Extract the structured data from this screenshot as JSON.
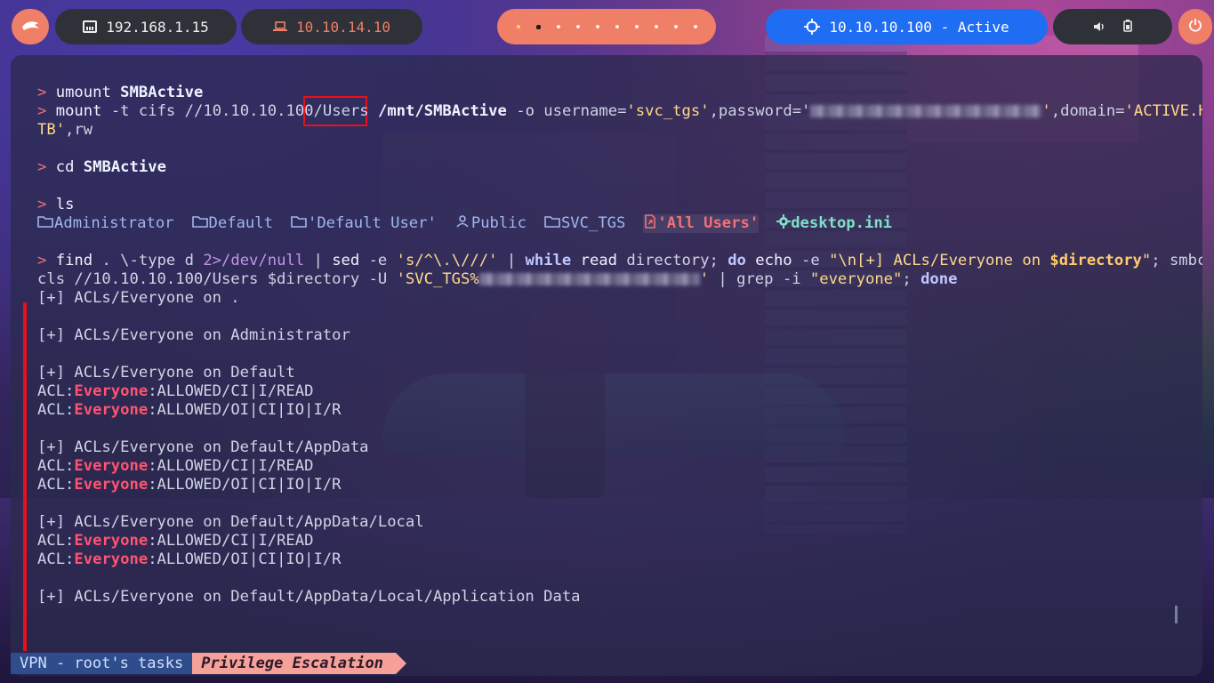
{
  "topbar": {
    "local_ip": "192.168.1.15",
    "vpn_ip": "10.10.14.10",
    "target": "10.10.10.100 - Active",
    "workspace_count": 10,
    "active_workspace_index": 1
  },
  "terminal": {
    "prompt_symbol": ">",
    "cmd1": {
      "c": "umount",
      "a": "SMBActive"
    },
    "cmd2": {
      "c": "mount",
      "flag_t": "-t",
      "type": "cifs",
      "path_pre": "//10.10.10.100",
      "path_share": "/Users",
      "mnt": "/mnt/SMBActive",
      "flag_o": "-o",
      "opt_user_key": "username=",
      "opt_user_val": "'svc_tgs'",
      "opt_pass_key": ",password='",
      "opt_pass_tail": "'",
      "opt_domain_key": ",domain=",
      "opt_domain_val1": "'ACTIVE.H",
      "opt_domain_val2": "TB'",
      "opt_rw": ",rw"
    },
    "cmd3": {
      "c": "cd",
      "a": "SMBActive"
    },
    "cmd4": {
      "c": "ls"
    },
    "ls": {
      "administrator": "Administrator",
      "default": "Default",
      "default_user": "'Default User'",
      "public": "Public",
      "svc_tgs": "SVC_TGS",
      "all_users": "'All Users'",
      "desktop_ini": "desktop.ini"
    },
    "cmd5": {
      "c": "find",
      "p1": ". \\-type d ",
      "redir": "2>/dev/null",
      "p2": " | ",
      "sed": "sed",
      "p3": " -e ",
      "sed_expr": "'s/^\\.\\///'",
      "p4": " | ",
      "while": "while",
      "read": " read",
      "p5": " directory; ",
      "do": "do",
      "echo": " echo",
      "p6": " -e ",
      "echo_str_a": "\"\\n[+] ACLs/Everyone on ",
      "echo_var": "$directory",
      "echo_str_b": "\"",
      "p7": "; smbca",
      "l2_a": "cls //10.10.10.100/Users $directory -U ",
      "l2_user": "'SVC_TGS%",
      "l2_tail": "'",
      "l2_b": " | grep -i ",
      "l2_str": "\"everyone\"",
      "l2_c": "; ",
      "done": "done"
    },
    "output": {
      "h1": "[+] ACLs/Everyone on .",
      "h2": "[+] ACLs/Everyone on Administrator",
      "h3": "[+] ACLs/Everyone on Default",
      "h4": "[+] ACLs/Everyone on Default/AppData",
      "h5": "[+] ACLs/Everyone on Default/AppData/Local",
      "h6": "[+] ACLs/Everyone on Default/AppData/Local/Application Data",
      "acl": "ACL:",
      "everyone": "Everyone",
      "read": ":ALLOWED/CI|I/READ",
      "r": ":ALLOWED/OI|CI|IO|I/R"
    }
  },
  "statusbar": {
    "task": "VPN - root's tasks",
    "mode": "Privilege Escalation"
  },
  "colors": {
    "accent": "#f07f67",
    "target_blue": "#1f6df3",
    "prompt": "#f07178",
    "everyone": "#ff5370",
    "highlight_box": "#e8101b"
  },
  "icons": [
    "arch-logo-icon",
    "network-icon",
    "laptop-icon",
    "crosshair-icon",
    "volume-icon",
    "battery-icon",
    "power-icon",
    "folder-icon",
    "user-icon",
    "symlink-icon",
    "gear-icon"
  ]
}
